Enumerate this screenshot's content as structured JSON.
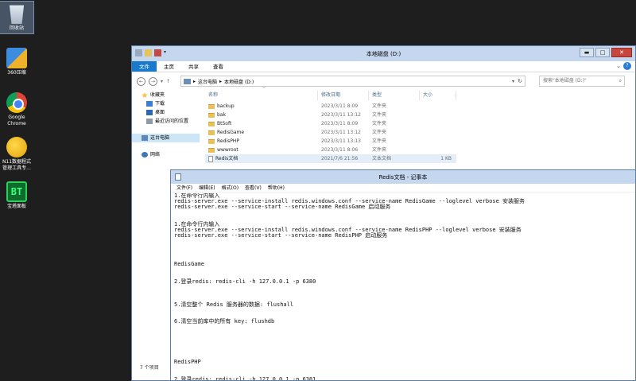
{
  "desktop": {
    "icons": [
      {
        "label": "回收站",
        "icon": "recycle-bin-icon"
      },
      {
        "label": "360压缩",
        "icon": "archive-360-icon"
      },
      {
        "label": "Google Chrome",
        "icon": "chrome-icon"
      },
      {
        "label": "N11数据程式管理工具专...",
        "icon": "n11-tool-icon"
      },
      {
        "label": "宝塔面板",
        "icon": "bt-panel-icon"
      }
    ]
  },
  "explorer": {
    "title": "本地磁盘 (D:)",
    "ribbon_tabs": [
      "文件",
      "主页",
      "共享",
      "查看"
    ],
    "address": {
      "segments": [
        "这台电脑",
        "本地磁盘 (D:)"
      ]
    },
    "search_placeholder": "搜索\"本地磁盘 (D:)\"",
    "nav": {
      "favorites": "收藏夹",
      "downloads": "下载",
      "desktop": "桌面",
      "recent": "最近访问的位置",
      "this_pc": "这台电脑",
      "network": "网络"
    },
    "columns": {
      "name": "名称",
      "date": "修改日期",
      "type": "类型",
      "size": "大小"
    },
    "files": [
      {
        "name": "backup",
        "date": "2023/3/11 8:09",
        "type": "文件夹",
        "size": "",
        "kind": "folder"
      },
      {
        "name": "bak",
        "date": "2023/3/11 13:12",
        "type": "文件夹",
        "size": "",
        "kind": "folder"
      },
      {
        "name": "BtSoft",
        "date": "2023/3/11 8:09",
        "type": "文件夹",
        "size": "",
        "kind": "folder"
      },
      {
        "name": "RedisGame",
        "date": "2023/3/11 13:12",
        "type": "文件夹",
        "size": "",
        "kind": "folder"
      },
      {
        "name": "RedisPHP",
        "date": "2023/3/11 13:13",
        "type": "文件夹",
        "size": "",
        "kind": "folder"
      },
      {
        "name": "wwwroot",
        "date": "2023/3/11 8:06",
        "type": "文件夹",
        "size": "",
        "kind": "folder"
      },
      {
        "name": "Redis文档",
        "date": "2021/7/6 21:56",
        "type": "文本文档",
        "size": "1 KB",
        "kind": "text"
      }
    ],
    "status": "7 个项目"
  },
  "notepad": {
    "title": "Redis文档 - 记事本",
    "menu": [
      "文件(F)",
      "编辑(E)",
      "格式(O)",
      "查看(V)",
      "帮助(H)"
    ],
    "text": "1.在命令行内输入\nredis-server.exe --service-install redis.windows.conf --service-name RedisGame --loglevel verbose 安装服务\nredis-server.exe --service-start --service-name RedisGame 启动服务\n\n\n1.在命令行内输入\nredis-server.exe --service-install redis.windows.conf --service-name RedisPHP --loglevel verbose 安装服务\nredis-server.exe --service-start --service-name RedisPHP 启动服务\n\n\n\n\nRedisGame\n\n\n2.登录redis: redis-cli -h 127.0.0.1 -p 6380\n\n\n\n5.清空整个 Redis 服务器的数据: flushall\n\n\n6.清空当前库中的所有 key: flushdb\n\n\n\n\n\n\nRedisPHP\n\n\n2.登录redis: redis-cli -h 127.0.0.1 -p 6381"
  }
}
